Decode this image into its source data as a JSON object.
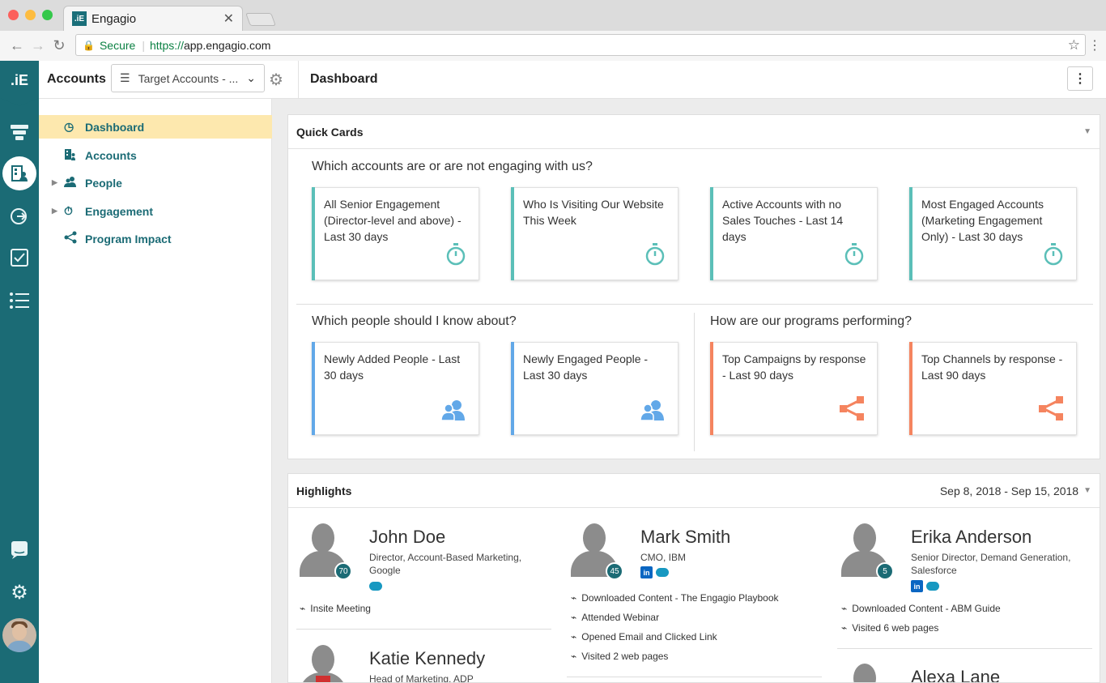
{
  "browser": {
    "tab_title": "Engagio",
    "secure_label": "Secure",
    "url_scheme": "https://",
    "url_host": "app.engagio.com"
  },
  "header": {
    "section_title": "Accounts",
    "selector_value": "Target Accounts - ...",
    "page_title": "Dashboard"
  },
  "sidebar": {
    "items": [
      {
        "label": "Dashboard",
        "icon": "dashboard-gauge-icon"
      },
      {
        "label": "Accounts",
        "icon": "building-icon"
      },
      {
        "label": "People",
        "icon": "people-icon"
      },
      {
        "label": "Engagement",
        "icon": "stopwatch-icon"
      },
      {
        "label": "Program Impact",
        "icon": "share-nodes-icon"
      }
    ]
  },
  "quick_cards": {
    "title": "Quick Cards",
    "q_accounts": "Which accounts are or are not engaging with us?",
    "q_people": "Which people should I know about?",
    "q_programs": "How are our programs performing?",
    "cards": [
      {
        "label": "All Senior Engagement (Director-level and above) - Last 30 days",
        "color": "#5bbfb8",
        "icon": "stopwatch-icon"
      },
      {
        "label": "Who Is Visiting Our Website This Week",
        "color": "#5bbfb8",
        "icon": "stopwatch-icon"
      },
      {
        "label": "Active Accounts with no Sales Touches - Last 14 days",
        "color": "#5bbfb8",
        "icon": "stopwatch-icon"
      },
      {
        "label": "Most Engaged Accounts (Marketing Engagement Only) - Last 30 days",
        "color": "#5bbfb8",
        "icon": "stopwatch-icon"
      },
      {
        "label": "Newly Added People - Last 30 days",
        "color": "#62a8e8",
        "icon": "people-icon"
      },
      {
        "label": "Newly Engaged People - Last 30 days",
        "color": "#62a8e8",
        "icon": "people-icon"
      },
      {
        "label": "Top Campaigns by response - Last 90 days",
        "color": "#f5845f",
        "icon": "share-nodes-icon"
      },
      {
        "label": "Top Channels by response - Last 90 days",
        "color": "#f5845f",
        "icon": "share-nodes-icon"
      }
    ]
  },
  "highlights": {
    "title": "Highlights",
    "date_range": "Sep 8, 2018 - Sep 15, 2018",
    "people": [
      {
        "name": "John Doe",
        "title": "Director, Account-Based Marketing, Google",
        "score": "70",
        "activities": [
          "Insite Meeting"
        ]
      },
      {
        "name": "Mark Smith",
        "title": "CMO, IBM",
        "score": "45",
        "activities": [
          "Downloaded Content - The Engagio Playbook",
          "Attended Webinar",
          "Opened Email and Clicked Link",
          "Visited 2 web pages"
        ]
      },
      {
        "name": "Erika Anderson",
        "title": "Senior Director, Demand Generation, Salesforce",
        "score": "5",
        "activities": [
          "Downloaded Content - ABM Guide",
          "Visited 6 web pages"
        ]
      },
      {
        "name": "Katie Kennedy",
        "title": "Head of Marketing, ADP"
      },
      {
        "name": "Alexa Lane"
      }
    ]
  },
  "colors": {
    "brand": "#1b6b75",
    "active_nav": "#fde8ae"
  }
}
